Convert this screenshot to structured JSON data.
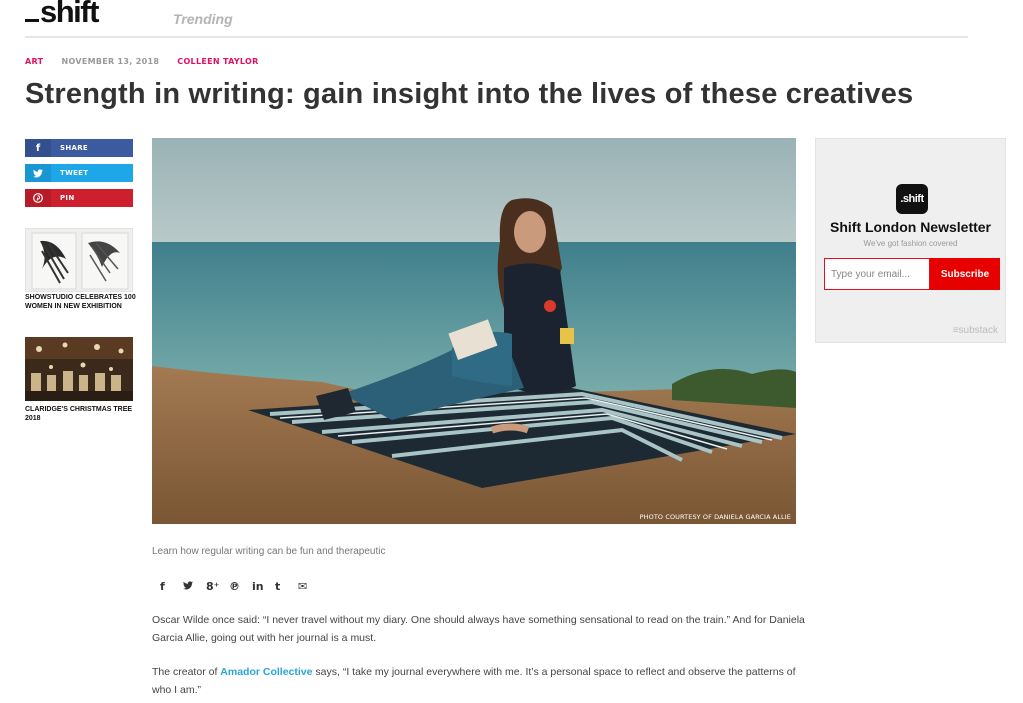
{
  "header": {
    "logo": "_shift",
    "logo_text": "shift",
    "trending": "Trending"
  },
  "article": {
    "category": "ART",
    "date": "NOVEMBER 13, 2018",
    "author": "COLLEEN TAYLOR",
    "headline": "Strength in writing: gain insight into the lives of these creatives",
    "photo_credit": "PHOTO COURTESY OF DANIELA GARCIA ALLIE",
    "dek": "Learn how regular writing can be fun and therapeutic",
    "para1": "Oscar Wilde once said: “I never travel without my diary. One should always have something sensational to read on the train.” And for Daniela Garcia Allie, going out with her journal is a must.",
    "para2_before": "The creator of ",
    "para2_link": "Amador Collective",
    "para2_after": " says, “I take my journal everywhere with me. It’s a personal space to reflect and observe the patterns of who I am.”"
  },
  "share": {
    "facebook": {
      "icon": "f",
      "label": "SHARE"
    },
    "twitter": {
      "icon": "🐦",
      "label": "TWEET"
    },
    "pinterest": {
      "icon": "℗",
      "label": "PIN"
    }
  },
  "related": [
    {
      "title": "SHOWSTUDIO CELEBRATES 100 WOMEN IN NEW EXHIBITION"
    },
    {
      "title": "CLARIDGE'S CHRISTMAS TREE 2018"
    }
  ],
  "social_icons": {
    "facebook": "f",
    "twitter": "🐦",
    "googleplus": "8⁺",
    "pinterest": "℗",
    "linkedin": "in",
    "tumblr": "t",
    "email": "✉"
  },
  "newsletter": {
    "logo": ".shift",
    "title": "Shift London Newsletter",
    "subtitle": "We've got fashion covered",
    "placeholder": "Type your email...",
    "button": "Subscribe",
    "brand": "substack",
    "brand_icon": "≡"
  },
  "colors": {
    "accent": "#e0115f",
    "link": "#29a6d8",
    "facebook": "#3b5aa0",
    "twitter": "#1da7e8",
    "pinterest": "#cd1f2e",
    "subscribe": "#e60000"
  }
}
